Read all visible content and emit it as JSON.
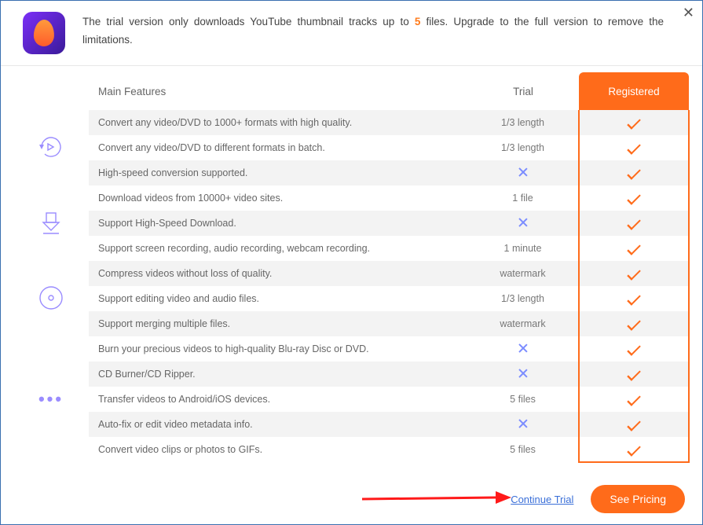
{
  "header": {
    "text_pre": "The trial version only downloads YouTube thumbnail tracks up to ",
    "highlight": "5",
    "text_post": " files. Upgrade to the full version to remove the limitations."
  },
  "columns": {
    "features": "Main Features",
    "trial": "Trial",
    "registered": "Registered"
  },
  "groups": [
    {
      "icon": "convert",
      "rows": [
        {
          "feature": "Convert any video/DVD to 1000+ formats with high quality.",
          "trial": "1/3 length",
          "type": "text"
        },
        {
          "feature": "Convert any video/DVD to different formats in batch.",
          "trial": "1/3 length",
          "type": "text"
        },
        {
          "feature": "High-speed conversion supported.",
          "trial": "",
          "type": "cross"
        }
      ]
    },
    {
      "icon": "download",
      "rows": [
        {
          "feature": "Download videos from 10000+ video sites.",
          "trial": "1 file",
          "type": "text"
        },
        {
          "feature": "Support High-Speed Download.",
          "trial": "",
          "type": "cross"
        },
        {
          "feature": "Support screen recording, audio recording, webcam recording.",
          "trial": "1 minute",
          "type": "text"
        }
      ]
    },
    {
      "icon": "disc",
      "rows": [
        {
          "feature": "Compress videos without loss of quality.",
          "trial": "watermark",
          "type": "text"
        },
        {
          "feature": "Support editing video and audio files.",
          "trial": "1/3 length",
          "type": "text"
        },
        {
          "feature": "Support merging multiple files.",
          "trial": "watermark",
          "type": "text"
        }
      ]
    },
    {
      "icon": "more",
      "rows": [
        {
          "feature": "Burn your precious videos to high-quality Blu-ray Disc or DVD.",
          "trial": "",
          "type": "cross"
        },
        {
          "feature": "CD Burner/CD Ripper.",
          "trial": "",
          "type": "cross"
        },
        {
          "feature": "Transfer videos to Android/iOS devices.",
          "trial": "5 files",
          "type": "text"
        },
        {
          "feature": "Auto-fix or edit video metadata info.",
          "trial": "",
          "type": "cross"
        },
        {
          "feature": "Convert video clips or photos to GIFs.",
          "trial": "5 files",
          "type": "text"
        }
      ]
    }
  ],
  "footer": {
    "continue": "Continue Trial",
    "pricing": "See Pricing"
  }
}
